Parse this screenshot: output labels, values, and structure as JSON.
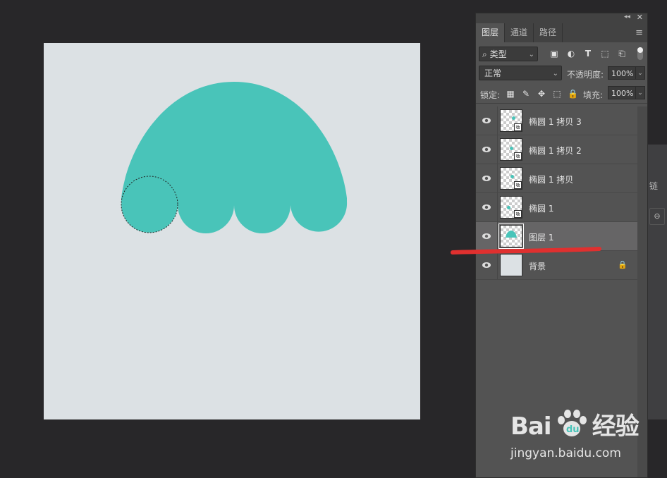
{
  "canvas": {
    "background_color": "#dce1e4",
    "shape_color": "#49c4b9"
  },
  "right_panel": {
    "edge_tab_text": "链",
    "link_icon": "link-icon"
  },
  "layers_panel": {
    "tabs": [
      {
        "label": "图层",
        "active": true
      },
      {
        "label": "通道",
        "active": false
      },
      {
        "label": "路径",
        "active": false
      }
    ],
    "filter": {
      "kind_label": "类型",
      "icons": [
        "image-filter-icon",
        "adjustment-filter-icon",
        "type-filter-icon",
        "shape-filter-icon",
        "smart-object-filter-icon"
      ]
    },
    "blend_mode": "正常",
    "opacity_label": "不透明度:",
    "opacity_value": "100%",
    "lock_label": "锁定:",
    "fill_label": "填充:",
    "fill_value": "100%",
    "layers": [
      {
        "name": "椭圆 1 拷贝 3",
        "visible": true,
        "smart_object": true,
        "selected": false
      },
      {
        "name": "椭圆 1 拷贝 2",
        "visible": true,
        "smart_object": true,
        "selected": false
      },
      {
        "name": "椭圆 1 拷贝",
        "visible": true,
        "smart_object": true,
        "selected": false
      },
      {
        "name": "椭圆 1",
        "visible": true,
        "smart_object": true,
        "selected": false
      },
      {
        "name": "图层 1",
        "visible": true,
        "smart_object": false,
        "selected": true
      },
      {
        "name": "背景",
        "visible": true,
        "smart_object": false,
        "selected": false,
        "locked": true
      }
    ]
  },
  "annotation": {
    "stroke_color": "#e0302f"
  },
  "watermark": {
    "brand_prefix": "Bai",
    "brand_suffix": "经验",
    "site": "jingyan.baidu.com"
  }
}
